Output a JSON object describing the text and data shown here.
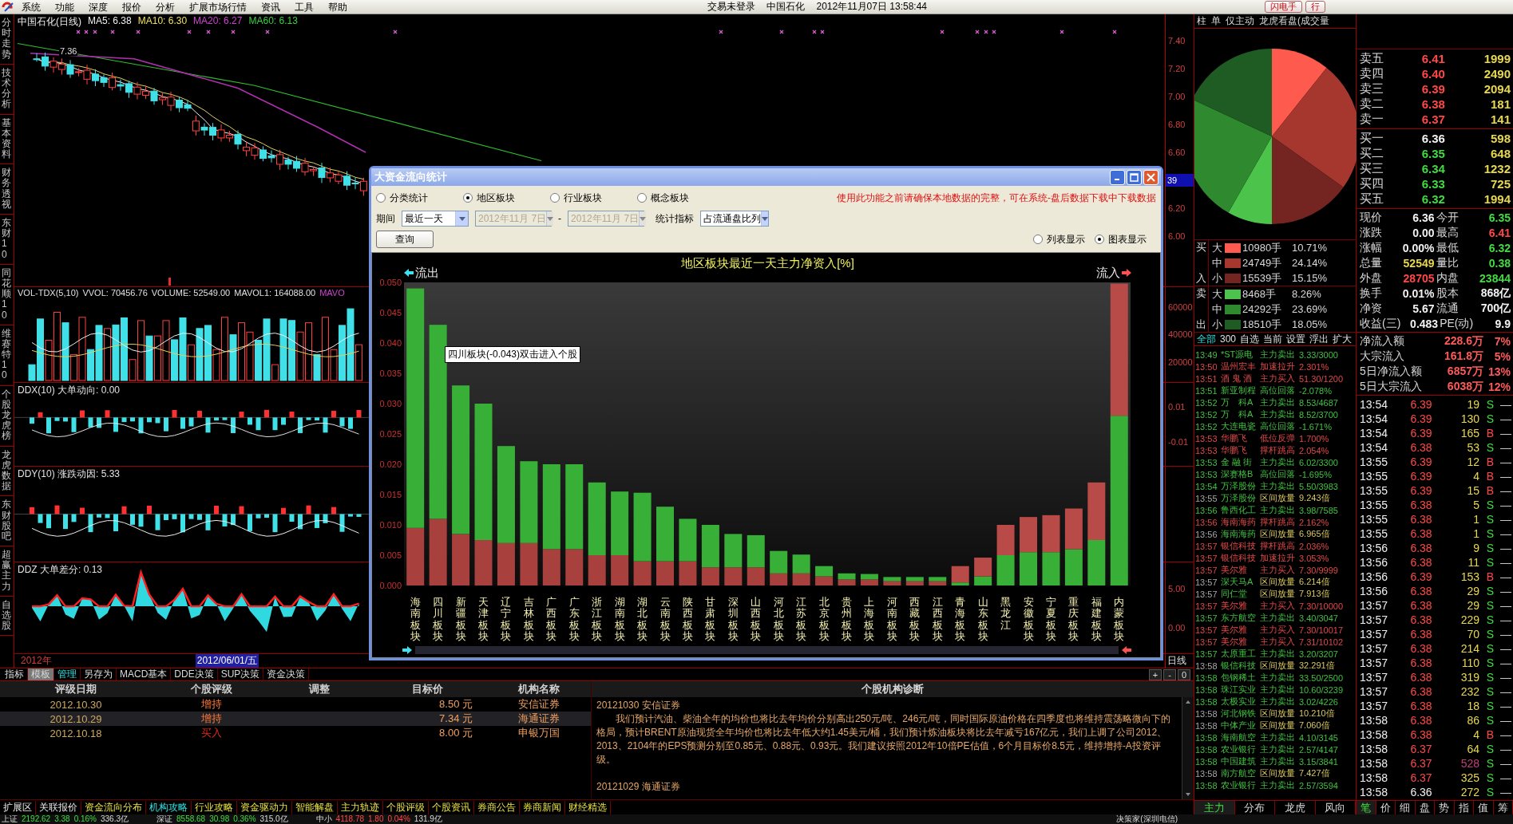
{
  "menu_bar": {
    "items": [
      "系统",
      "功能",
      "深度",
      "报价",
      "分析",
      "扩展市场行情",
      "资讯",
      "工具",
      "帮助"
    ],
    "login_status": "交易未登录",
    "stock": "中国石化",
    "datetime": "2012年11月07日 13:58:44",
    "buttons": [
      "闪电手",
      "行"
    ]
  },
  "side_tabs": [
    "分时走势",
    "技术分析",
    "基本资料",
    "财务透视",
    "东财10",
    "同花顺10",
    "维赛特10",
    "个股龙虎榜",
    "龙虎数据",
    "东财股吧",
    "超赢主力",
    "自选股"
  ],
  "chart": {
    "title": "中国石化(日线)",
    "indicators": [
      {
        "text": "MA5: 6.38",
        "color": "#f0f0f0"
      },
      {
        "text": "MA10: 6.30",
        "color": "#f0e060"
      },
      {
        "text": "MA20: 6.27",
        "color": "#d040d0"
      },
      {
        "text": "MA60: 6.13",
        "color": "#40d040"
      }
    ],
    "high_label": "7.36",
    "price_ticks": [
      {
        "label": "7.40",
        "kind": "tick"
      },
      {
        "label": "7.20",
        "kind": "tick"
      },
      {
        "label": "7.00",
        "kind": "tick"
      },
      {
        "label": "6.80",
        "kind": "tick"
      },
      {
        "label": "6.60",
        "kind": "tick"
      },
      {
        "label": "39",
        "kind": "marker"
      },
      {
        "label": "6.20",
        "kind": "tick"
      },
      {
        "label": "6.00",
        "kind": "tick"
      }
    ]
  },
  "panels": [
    {
      "kind": "volume",
      "legend": [
        {
          "text": "VOL-TDX(5,10)",
          "color": "#e0e0e0"
        },
        {
          "text": "VVOL: 70456.76",
          "color": "#e0e0e0"
        },
        {
          "text": "VOLUME: 52549.00",
          "color": "#e0e0e0"
        },
        {
          "text": "MAVOL1: 164088.00",
          "color": "#e0e0e0"
        },
        {
          "text": "MAVO",
          "color": "#d040d0"
        }
      ],
      "ticks": [
        "60000",
        "40000",
        "20000"
      ]
    },
    {
      "kind": "ddx",
      "legend": [
        {
          "text": "DDX(10) 大单动向: 0.00",
          "color": "#e0e0e0"
        }
      ],
      "ticks": [
        "0.01",
        "-0.01"
      ]
    },
    {
      "kind": "ddy",
      "legend": [
        {
          "text": "DDY(10) 涨跌动因: 5.33",
          "color": "#e0e0e0"
        }
      ]
    },
    {
      "kind": "ddz",
      "legend": [
        {
          "text": "DDZ 大单差分: 0.13",
          "color": "#e0e0e0"
        }
      ],
      "ticks": [
        "5.00",
        "0.00"
      ]
    }
  ],
  "date_axis": {
    "start": "2012年",
    "cursor": "2012/06/01/五",
    "period": "日线"
  },
  "dialog": {
    "title": "大资金流向统计",
    "modes": [
      {
        "label": "分类统计",
        "selected": false
      },
      {
        "label": "地区板块",
        "selected": true
      },
      {
        "label": "行业板块",
        "selected": false
      },
      {
        "label": "概念板块",
        "selected": false
      }
    ],
    "notice": "使用此功能之前请确保本地数据的完整，可在系统-盘后数据下载中下载数据",
    "period_label": "期间",
    "period": "最近一天",
    "date_range": [
      {
        "value": "2012年11月 7日",
        "disabled": true
      },
      {
        "value": "2012年11月 7日",
        "disabled": true
      }
    ],
    "date_separator": "-",
    "metric_label": "统计指标",
    "metric": "占流通盘比列",
    "query_button": "查询",
    "views": [
      {
        "label": "列表显示",
        "selected": false
      },
      {
        "label": "图表显示",
        "selected": true
      }
    ],
    "outflow_label": "流出",
    "inflow_label": "流入",
    "tooltip": "四川板块(-0.043)双击进入个股",
    "chart_data": {
      "type": "bar",
      "title": "地区板块最近一天主力净资入[%]",
      "stacked": true,
      "ylim": [
        0,
        0.05
      ],
      "yticks": [
        {
          "value": 0,
          "label": "0.000"
        },
        {
          "value": 0.005,
          "label": "0.005"
        },
        {
          "value": 0.01,
          "label": "0.010"
        },
        {
          "value": 0.015,
          "label": "0.015"
        },
        {
          "value": 0.02,
          "label": "0.020"
        },
        {
          "value": 0.025,
          "label": "0.025"
        },
        {
          "value": 0.03,
          "label": "0.030"
        },
        {
          "value": 0.035,
          "label": "0.035"
        },
        {
          "value": 0.04,
          "label": "0.040"
        },
        {
          "value": 0.045,
          "label": "0.045"
        },
        {
          "value": 0.05,
          "label": "0.050"
        }
      ],
      "categories": [
        "海南板块",
        "四川板块",
        "新疆板块",
        "天津板块",
        "辽宁板块",
        "吉林板块",
        "广西板块",
        "广东板块",
        "浙江板块",
        "湖南板块",
        "湖北板块",
        "云南板块",
        "陕西板块",
        "甘肃板块",
        "深圳板块",
        "山西板块",
        "河北板块",
        "江苏板块",
        "北京板块",
        "贵州板块",
        "上海板块",
        "河南板块",
        "西藏板块",
        "江西板块",
        "青海板块",
        "山东板块",
        "黑龙江",
        "安徽板块",
        "宁夏板块",
        "重庆板块",
        "福建板块",
        "内蒙板块"
      ],
      "series": [
        {
          "color": "#a8403e",
          "values": [
            0.0095,
            0.011,
            0.0085,
            0.0075,
            0.007,
            0.007,
            0.006,
            0.006,
            0.005,
            0.005,
            0.004,
            0.004,
            0.004,
            0.003,
            0.003,
            0.003,
            0.002,
            0.002,
            0.0015,
            0.001,
            0.001,
            0.0007,
            0.0007,
            0.0007,
            0,
            0,
            0,
            0,
            0,
            0,
            0,
            0
          ]
        },
        {
          "color": "#38b038",
          "values": [
            0.0395,
            0.032,
            0.0245,
            0.0225,
            0.016,
            0.0135,
            0.014,
            0.014,
            0.012,
            0.0105,
            0.0113,
            0.009,
            0.007,
            0.007,
            0.0055,
            0.0053,
            0.0037,
            0.0031,
            0.0017,
            0.001,
            0.0009,
            0.0007,
            0.0007,
            0.0007,
            0.0005,
            0.0015,
            0.005,
            0.0055,
            0.0055,
            0.006,
            0.0075,
            0.028
          ]
        },
        {
          "color": "#b84a48",
          "values": [
            0,
            0,
            0,
            0,
            0,
            0,
            0,
            0,
            0,
            0,
            0,
            0,
            0,
            0,
            0,
            0,
            0,
            0,
            0,
            0,
            0,
            0,
            0,
            0,
            0.0027,
            0.0031,
            0.005,
            0.0058,
            0.0061,
            0.0067,
            0.0095,
            0.0218
          ]
        }
      ]
    }
  },
  "right_panel": {
    "tabs": [
      "柱",
      "单",
      "仅主动",
      "龙虎看盘(成交量"
    ],
    "pie": {
      "chart_data": {
        "type": "pie",
        "categories": [
          "大",
          "中",
          "小",
          "大",
          "中",
          "小"
        ],
        "values": [
          10.71,
          24.14,
          15.15,
          8.26,
          23.69,
          18.05
        ]
      }
    },
    "flow_groups": [
      {
        "side": [
          "买",
          "入"
        ],
        "rows": [
          {
            "volume": "10980手",
            "percent": "10.71%",
            "color": "#ff5a4e"
          },
          {
            "volume": "24749手",
            "percent": "24.14%",
            "color": "#a5372f"
          },
          {
            "volume": "15539手",
            "percent": "15.15%",
            "color": "#742521"
          }
        ]
      },
      {
        "side": [
          "卖",
          "出"
        ],
        "rows": [
          {
            "volume": "8468手",
            "percent": "8.26%",
            "color": "#4cc44c"
          },
          {
            "volume": "24292手",
            "percent": "23.69%",
            "color": "#2f8a2f"
          },
          {
            "volume": "18510手",
            "percent": "18.05%",
            "color": "#1f5c24"
          }
        ]
      }
    ],
    "alert_filters": [
      {
        "label": "全部",
        "selected": true
      },
      {
        "label": "300",
        "selected": false
      },
      {
        "label": "自选",
        "selected": false
      },
      {
        "label": "当前",
        "selected": false
      },
      {
        "label": "设置",
        "selected": false
      },
      {
        "label": "浮出",
        "selected": false
      },
      {
        "label": "扩大",
        "selected": false
      }
    ],
    "alerts": [
      {
        "time": "13:49",
        "name": "*ST源电",
        "event": "主力卖出",
        "value": "3.33/3000",
        "kind": "fall"
      },
      {
        "time": "13:50",
        "name": "温州宏丰",
        "event": "加速拉升",
        "value": "2.301%",
        "kind": "rise"
      },
      {
        "time": "13:51",
        "name": "酒 鬼 酒",
        "event": "主力买入",
        "value": "51.30/1200",
        "kind": "rise"
      },
      {
        "time": "13:51",
        "name": "新亚制程",
        "event": "高位回落",
        "value": "-2.078%",
        "kind": "fall"
      },
      {
        "time": "13:52",
        "name": "万　科A",
        "event": "主力卖出",
        "value": "8.53/4687",
        "kind": "fall"
      },
      {
        "time": "13:52",
        "name": "万　科A",
        "event": "主力卖出",
        "value": "8.52/3700",
        "kind": "fall"
      },
      {
        "time": "13:52",
        "name": "大连电瓷",
        "event": "高位回落",
        "value": "-1.671%",
        "kind": "fall"
      },
      {
        "time": "13:53",
        "name": "华鹏飞",
        "event": "低位反弹",
        "value": "1.700%",
        "kind": "rise"
      },
      {
        "time": "13:53",
        "name": "华鹏飞",
        "event": "撑杆跳高",
        "value": "2.054%",
        "kind": "rise"
      },
      {
        "time": "13:53",
        "name": "金 融 街",
        "event": "主力卖出",
        "value": "6.02/3300",
        "kind": "fall"
      },
      {
        "time": "13:53",
        "name": "深赛格B",
        "event": "高位回落",
        "value": "-1.695%",
        "kind": "fall"
      },
      {
        "time": "13:54",
        "name": "万泽股份",
        "event": "主力卖出",
        "value": "5.50/3983",
        "kind": "fall"
      },
      {
        "time": "13:55",
        "name": "万泽股份",
        "event": "区间放量",
        "value": "9.243倍",
        "kind": "volume"
      },
      {
        "time": "13:56",
        "name": "鲁西化工",
        "event": "主力卖出",
        "value": "3.98/7585",
        "kind": "fall"
      },
      {
        "time": "13:56",
        "name": "海南海药",
        "event": "撑杆跳高",
        "value": "2.162%",
        "kind": "rise"
      },
      {
        "time": "13:56",
        "name": "海南海药",
        "event": "区间放量",
        "value": "6.965倍",
        "kind": "volume"
      },
      {
        "time": "13:57",
        "name": "银信科技",
        "event": "撑杆跳高",
        "value": "2.036%",
        "kind": "rise"
      },
      {
        "time": "13:57",
        "name": "银信科技",
        "event": "加速拉升",
        "value": "3.053%",
        "kind": "rise"
      },
      {
        "time": "13:57",
        "name": "美尔雅",
        "event": "主力买入",
        "value": "7.30/9999",
        "kind": "rise"
      },
      {
        "time": "13:57",
        "name": "深天马A",
        "event": "区间放量",
        "value": "6.214倍",
        "kind": "volume"
      },
      {
        "time": "13:57",
        "name": "同仁堂",
        "event": "区间放量",
        "value": "7.913倍",
        "kind": "volume"
      },
      {
        "time": "13:57",
        "name": "美尔雅",
        "event": "主力买入",
        "value": "7.30/10000",
        "kind": "rise"
      },
      {
        "time": "13:57",
        "name": "东方航空",
        "event": "主力卖出",
        "value": "3.40/3047",
        "kind": "fall"
      },
      {
        "time": "13:57",
        "name": "美尔雅",
        "event": "主力买入",
        "value": "7.30/10017",
        "kind": "rise"
      },
      {
        "time": "13:57",
        "name": "美尔雅",
        "event": "主力买入",
        "value": "7.31/10102",
        "kind": "rise"
      },
      {
        "time": "13:57",
        "name": "太原重工",
        "event": "主力卖出",
        "value": "3.20/3207",
        "kind": "fall"
      },
      {
        "time": "13:58",
        "name": "银信科技",
        "event": "区间放量",
        "value": "32.291倍",
        "kind": "volume"
      },
      {
        "time": "13:58",
        "name": "包钢稀土",
        "event": "主力卖出",
        "value": "33.50/2500",
        "kind": "fall"
      },
      {
        "time": "13:58",
        "name": "珠江实业",
        "event": "主力卖出",
        "value": "10.60/3239",
        "kind": "fall"
      },
      {
        "time": "13:58",
        "name": "太极实业",
        "event": "主力卖出",
        "value": "3.02/4226",
        "kind": "fall"
      },
      {
        "time": "13:58",
        "name": "河北钢铁",
        "event": "区间放量",
        "value": "10.210倍",
        "kind": "volume"
      },
      {
        "time": "13:58",
        "name": "中体产业",
        "event": "区间放量",
        "value": "7.060倍",
        "kind": "volume"
      },
      {
        "time": "13:58",
        "name": "海南航空",
        "event": "主力卖出",
        "value": "4.10/3145",
        "kind": "fall"
      },
      {
        "time": "13:58",
        "name": "农业银行",
        "event": "主力卖出",
        "value": "2.57/4147",
        "kind": "fall"
      },
      {
        "time": "13:58",
        "name": "中国建筑",
        "event": "主力卖出",
        "value": "3.15/3841",
        "kind": "fall"
      },
      {
        "time": "13:58",
        "name": "南方航空",
        "event": "区间放量",
        "value": "7.427倍",
        "kind": "volume"
      },
      {
        "time": "13:58",
        "name": "农业银行",
        "event": "主力卖出",
        "value": "2.57/3594",
        "kind": "fall"
      }
    ],
    "monitor_tabs": [
      {
        "label": "主力",
        "selected": true
      },
      {
        "label": "分布",
        "selected": false
      },
      {
        "label": "龙虎",
        "selected": false
      },
      {
        "label": "风向",
        "selected": false
      }
    ],
    "asks": [
      {
        "label": "卖五",
        "price": "6.41",
        "volume": "1999",
        "kind": "up"
      },
      {
        "label": "卖四",
        "price": "6.40",
        "volume": "2490",
        "kind": "up"
      },
      {
        "label": "卖三",
        "price": "6.39",
        "volume": "2094",
        "kind": "up"
      },
      {
        "label": "卖二",
        "price": "6.38",
        "volume": "181",
        "kind": "up"
      },
      {
        "label": "卖一",
        "price": "6.37",
        "volume": "141",
        "kind": "up"
      }
    ],
    "bids": [
      {
        "label": "买一",
        "price": "6.36",
        "volume": "598",
        "kind": "flat"
      },
      {
        "label": "买二",
        "price": "6.35",
        "volume": "648",
        "kind": "down"
      },
      {
        "label": "买三",
        "price": "6.34",
        "volume": "1232",
        "kind": "down"
      },
      {
        "label": "买四",
        "price": "6.33",
        "volume": "725",
        "kind": "down"
      },
      {
        "label": "买五",
        "price": "6.32",
        "volume": "1994",
        "kind": "down"
      }
    ],
    "quote_rows": [
      [
        {
          "label": "现价",
          "value": "6.36",
          "kind": "flat"
        },
        {
          "label": "今开",
          "value": "6.35",
          "kind": "down"
        }
      ],
      [
        {
          "label": "涨跌",
          "value": "0.00",
          "kind": "flat"
        },
        {
          "label": "最高",
          "value": "6.41",
          "kind": "up"
        }
      ],
      [
        {
          "label": "涨幅",
          "value": "0.00%",
          "kind": "flat"
        },
        {
          "label": "最低",
          "value": "6.32",
          "kind": "down"
        }
      ],
      [
        {
          "label": "总量",
          "value": "52549",
          "kind": "volume"
        },
        {
          "label": "量比",
          "value": "0.38",
          "kind": "down"
        }
      ],
      [
        {
          "label": "外盘",
          "value": "28705",
          "kind": "up"
        },
        {
          "label": "内盘",
          "value": "23844",
          "kind": "down"
        }
      ],
      [
        {
          "label": "换手",
          "value": "0.01%",
          "kind": "flat"
        },
        {
          "label": "股本",
          "value": "868亿",
          "kind": "flat"
        }
      ],
      [
        {
          "label": "净资",
          "value": "5.67",
          "kind": "flat"
        },
        {
          "label": "流通",
          "value": "700亿",
          "kind": "flat"
        }
      ],
      [
        {
          "label": "收益(三)",
          "value": "0.483",
          "kind": "flat"
        },
        {
          "label": "PE(动)",
          "value": "9.9",
          "kind": "flat"
        }
      ]
    ],
    "money_rows": [
      {
        "label": "净流入额",
        "value": "228.6万",
        "percent": "7%"
      },
      {
        "label": "大宗流入",
        "value": "161.8万",
        "percent": "5%"
      },
      {
        "label": "5日净流入额",
        "value": "6857万",
        "percent": "13%"
      },
      {
        "label": "5日大宗流入",
        "value": "6038万",
        "percent": "12%"
      }
    ],
    "ticks": [
      {
        "time": "13:54",
        "price": "6.39",
        "volume": "19",
        "side": "S",
        "kind": "up",
        "buy": false,
        "large": false,
        "trail": "—"
      },
      {
        "time": "13:54",
        "price": "6.39",
        "volume": "130",
        "side": "S",
        "kind": "up",
        "buy": false,
        "large": false,
        "trail": "—"
      },
      {
        "time": "13:54",
        "price": "6.39",
        "volume": "165",
        "side": "B",
        "kind": "up",
        "buy": true,
        "large": false,
        "trail": "—"
      },
      {
        "time": "13:54",
        "price": "6.38",
        "volume": "53",
        "side": "S",
        "kind": "up",
        "buy": false,
        "large": false,
        "trail": "—"
      },
      {
        "time": "13:55",
        "price": "6.39",
        "volume": "12",
        "side": "B",
        "kind": "up",
        "buy": true,
        "large": false,
        "trail": "—"
      },
      {
        "time": "13:55",
        "price": "6.39",
        "volume": "4",
        "side": "B",
        "kind": "up",
        "buy": true,
        "large": false,
        "trail": "—"
      },
      {
        "time": "13:55",
        "price": "6.39",
        "volume": "15",
        "side": "B",
        "kind": "up",
        "buy": true,
        "large": false,
        "trail": "—"
      },
      {
        "time": "13:55",
        "price": "6.38",
        "volume": "5",
        "side": "S",
        "kind": "up",
        "buy": false,
        "large": false,
        "trail": "—"
      },
      {
        "time": "13:55",
        "price": "6.38",
        "volume": "1",
        "side": "S",
        "kind": "up",
        "buy": false,
        "large": false,
        "trail": "—"
      },
      {
        "time": "13:55",
        "price": "6.38",
        "volume": "1",
        "side": "S",
        "kind": "up",
        "buy": false,
        "large": false,
        "trail": "—"
      },
      {
        "time": "13:56",
        "price": "6.38",
        "volume": "9",
        "side": "S",
        "kind": "up",
        "buy": false,
        "large": false,
        "trail": "—"
      },
      {
        "time": "13:56",
        "price": "6.38",
        "volume": "11",
        "side": "S",
        "kind": "up",
        "buy": false,
        "large": false,
        "trail": "—"
      },
      {
        "time": "13:56",
        "price": "6.39",
        "volume": "153",
        "side": "B",
        "kind": "up",
        "buy": true,
        "large": false,
        "trail": "—"
      },
      {
        "time": "13:56",
        "price": "6.38",
        "volume": "29",
        "side": "S",
        "kind": "up",
        "buy": false,
        "large": false,
        "trail": "—"
      },
      {
        "time": "13:57",
        "price": "6.38",
        "volume": "29",
        "side": "S",
        "kind": "up",
        "buy": false,
        "large": false,
        "trail": "—"
      },
      {
        "time": "13:57",
        "price": "6.38",
        "volume": "229",
        "side": "S",
        "kind": "up",
        "buy": false,
        "large": false,
        "trail": "—"
      },
      {
        "time": "13:57",
        "price": "6.38",
        "volume": "70",
        "side": "S",
        "kind": "up",
        "buy": false,
        "large": false,
        "trail": "—"
      },
      {
        "time": "13:57",
        "price": "6.38",
        "volume": "214",
        "side": "S",
        "kind": "up",
        "buy": false,
        "large": false,
        "trail": "—"
      },
      {
        "time": "13:57",
        "price": "6.38",
        "volume": "110",
        "side": "S",
        "kind": "up",
        "buy": false,
        "large": false,
        "trail": "—"
      },
      {
        "time": "13:57",
        "price": "6.38",
        "volume": "319",
        "side": "S",
        "kind": "up",
        "buy": false,
        "large": false,
        "trail": "—"
      },
      {
        "time": "13:57",
        "price": "6.38",
        "volume": "232",
        "side": "S",
        "kind": "up",
        "buy": false,
        "large": false,
        "trail": "—"
      },
      {
        "time": "13:57",
        "price": "6.38",
        "volume": "18",
        "side": "S",
        "kind": "up",
        "buy": false,
        "large": false,
        "trail": "—"
      },
      {
        "time": "13:58",
        "price": "6.38",
        "volume": "86",
        "side": "S",
        "kind": "up",
        "buy": false,
        "large": false,
        "trail": "—"
      },
      {
        "time": "13:58",
        "price": "6.38",
        "volume": "4",
        "side": "B",
        "kind": "up",
        "buy": true,
        "large": false,
        "trail": "—"
      },
      {
        "time": "13:58",
        "price": "6.37",
        "volume": "64",
        "side": "S",
        "kind": "up",
        "buy": false,
        "large": false,
        "trail": "—"
      },
      {
        "time": "13:58",
        "price": "6.37",
        "volume": "528",
        "side": "S",
        "kind": "up",
        "buy": false,
        "large": true,
        "trail": "—"
      },
      {
        "time": "13:58",
        "price": "6.37",
        "volume": "325",
        "side": "S",
        "kind": "up",
        "buy": false,
        "large": false,
        "trail": "—"
      },
      {
        "time": "13:58",
        "price": "6.36",
        "volume": "272",
        "side": "S",
        "kind": "flat",
        "buy": false,
        "large": false,
        "trail": "—"
      }
    ],
    "detail_tabs": [
      {
        "label": "笔",
        "selected": true
      },
      {
        "label": "价",
        "selected": false
      },
      {
        "label": "细",
        "selected": false
      },
      {
        "label": "盘",
        "selected": false
      },
      {
        "label": "势",
        "selected": false
      },
      {
        "label": "指",
        "selected": false
      },
      {
        "label": "值",
        "selected": false
      },
      {
        "label": "筹",
        "selected": false
      }
    ]
  },
  "indicator_tabs": [
    {
      "label": "指标",
      "selected": false,
      "highlight": false
    },
    {
      "label": "模板",
      "selected": true,
      "highlight": false
    },
    {
      "label": "管理",
      "selected": false,
      "highlight": true
    },
    {
      "label": "另存为",
      "selected": false,
      "highlight": false
    },
    {
      "label": "MACD基本",
      "selected": false,
      "highlight": false
    },
    {
      "label": "DDE决策",
      "selected": false,
      "highlight": false
    },
    {
      "label": "SUP决策",
      "selected": false,
      "highlight": false
    },
    {
      "label": "资金决策",
      "selected": false,
      "highlight": false
    }
  ],
  "zoom_buttons": [
    "+",
    "-",
    "0"
  ],
  "ratings": {
    "columns": [
      "评级日期",
      "个股评级",
      "调整",
      "目标价",
      "机构名称"
    ],
    "rows": [
      {
        "date": "2012.10.30",
        "rating": "增持",
        "kind": "hold",
        "target": "8.50 元",
        "broker": "安信证券",
        "selected": false
      },
      {
        "date": "2012.10.29",
        "rating": "增持",
        "kind": "hold",
        "target": "7.34 元",
        "broker": "海通证券",
        "selected": true
      },
      {
        "date": "2012.10.18",
        "rating": "买入",
        "kind": "buy",
        "target": "8.00 元",
        "broker": "申银万国",
        "selected": false
      }
    ]
  },
  "diagnosis": {
    "title": "个股机构诊断",
    "entries": [
      {
        "heading": "20121030 安信证券",
        "body": "我们预计汽油、柴油全年的均价也将比去年均价分别高出250元/吨、246元/吨，同时国际原油价格在四季度也将维持震荡略微向下的格局，预计BRENT原油现货全年均价也将比去年低大约1.45美元/桶，我们预计炼油板块将比去年减亏167亿元，我们上调了公司2012、2013、2104年的EPS预测分别至0.85元、0.88元、0.93元。我们建议按照2012年10倍PE估值，6个月目标价8.5元，维持增持-A投资评级。"
      },
      {
        "heading": "20121029 海通证券"
      }
    ]
  },
  "function_tabs": [
    {
      "label": "扩展区",
      "kind": "area",
      "selected": false
    },
    {
      "label": "关联报价",
      "kind": "area",
      "selected": false
    },
    {
      "label": "资金流向分布",
      "kind": "feature",
      "selected": false
    },
    {
      "label": "机构攻略",
      "kind": "feature",
      "selected": true
    },
    {
      "label": "行业攻略",
      "kind": "feature",
      "selected": false
    },
    {
      "label": "资金驱动力",
      "kind": "feature",
      "selected": false
    },
    {
      "label": "智能解盘",
      "kind": "feature",
      "selected": false
    },
    {
      "label": "主力轨迹",
      "kind": "feature",
      "selected": false
    },
    {
      "label": "个股评级",
      "kind": "feature",
      "selected": false
    },
    {
      "label": "个股资讯",
      "kind": "feature",
      "selected": false
    },
    {
      "label": "券商公告",
      "kind": "feature",
      "selected": false
    },
    {
      "label": "券商新闻",
      "kind": "feature",
      "selected": false
    },
    {
      "label": "财经精选",
      "kind": "feature",
      "selected": false
    }
  ],
  "status_bar": {
    "indices": [
      {
        "name": "上证",
        "value": "2192.62",
        "change": "3.38",
        "percent": "0.16%",
        "amount": "336.3亿",
        "kind": "down"
      },
      {
        "name": "深证",
        "value": "8558.68",
        "change": "30.98",
        "percent": "0.36%",
        "amount": "315.0亿",
        "kind": "down"
      },
      {
        "name": "中小",
        "value": "4118.78",
        "change": "1.80",
        "percent": "0.04%",
        "amount": "131.9亿",
        "kind": "up"
      }
    ],
    "server": "决策家(深圳电信)"
  }
}
